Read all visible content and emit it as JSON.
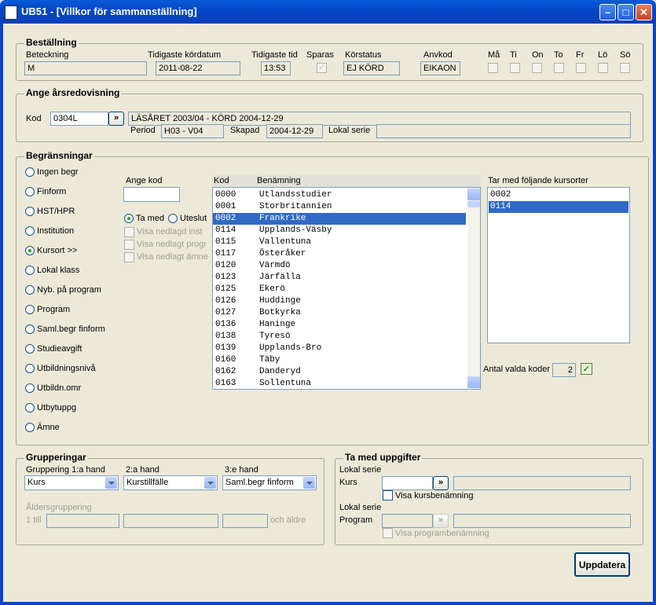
{
  "window": {
    "title": "UB51 - [Villkor för sammanställning]"
  },
  "order": {
    "section_title": "Beställning",
    "labels": {
      "beteckning": "Beteckning",
      "tidigaste_kordatum": "Tidigaste kördatum",
      "tidigaste_tid": "Tidigaste tid",
      "sparas": "Sparas",
      "korstatus": "Körstatus",
      "anvkod": "Anvkod"
    },
    "values": {
      "beteckning": "M",
      "tidigaste_kordatum": "2011-08-22",
      "tidigaste_tid": "13:53",
      "korstatus": "EJ KÖRD",
      "anvkod": "EIKAON"
    },
    "days": [
      "Må",
      "Ti",
      "On",
      "To",
      "Fr",
      "Lö",
      "Sö"
    ]
  },
  "annual": {
    "section_title": "Ange årsredovisning",
    "kod_label": "Kod",
    "kod_value": "0304L",
    "browse_label": "»",
    "description": "LÄSÅRET 2003/04 - KÖRD 2004-12-29",
    "period_label": "Period",
    "period_value": "H03 - V04",
    "skapad_label": "Skapad",
    "skapad_value": "2004-12-29",
    "lokal_serie_label": "Lokal serie",
    "lokal_serie_value": ""
  },
  "limits": {
    "section_title": "Begränsningar",
    "options": [
      "Ingen begr",
      "Finform",
      "HST/HPR",
      "Institution",
      "Kursort >>",
      "Lokal klass",
      "Nyb. på program",
      "Program",
      "Saml.begr finform",
      "Studieavgift",
      "Utbildningsnivå",
      "Utbildn.omr",
      "Utbytuppg",
      "Ämne"
    ],
    "ange_kod_label": "Ange kod",
    "ange_kod_value": "",
    "ta_med_label": "Ta med",
    "uteslut_label": "Uteslut",
    "visa_nedlagd_inst": "Visa nedlagd inst",
    "visa_nedlagt_progr": "Visa nedlagt progr",
    "visa_nedlagt_amne": "Visa nedlagt ämne",
    "list_headers": {
      "kod": "Kod",
      "benamning": "Benämning"
    },
    "list_rows": [
      {
        "kod": "0000",
        "name": "Utlandsstudier"
      },
      {
        "kod": "0001",
        "name": "Storbritannien"
      },
      {
        "kod": "0002",
        "name": "Frankrike"
      },
      {
        "kod": "0114",
        "name": "Upplands-Väsby"
      },
      {
        "kod": "0115",
        "name": "Vallentuna"
      },
      {
        "kod": "0117",
        "name": "Österåker"
      },
      {
        "kod": "0120",
        "name": "Värmdö"
      },
      {
        "kod": "0123",
        "name": "Järfälla"
      },
      {
        "kod": "0125",
        "name": "Ekerö"
      },
      {
        "kod": "0126",
        "name": "Huddinge"
      },
      {
        "kod": "0127",
        "name": "Botkyrka"
      },
      {
        "kod": "0136",
        "name": "Haninge"
      },
      {
        "kod": "0138",
        "name": "Tyresö"
      },
      {
        "kod": "0139",
        "name": "Upplands-Bro"
      },
      {
        "kod": "0160",
        "name": "Täby"
      },
      {
        "kod": "0162",
        "name": "Danderyd"
      },
      {
        "kod": "0163",
        "name": "Sollentuna"
      }
    ],
    "selected_list_row": "0002",
    "tar_med_label": "Tar med följande kursorter",
    "tar_med_items": [
      "0002",
      "0114"
    ],
    "antal_label": "Antal valda koder",
    "antal_value": "2"
  },
  "grouping": {
    "section_title": "Grupperingar",
    "g1_label": "Gruppering 1:a hand",
    "g1_value": "Kurs",
    "g2_label": "2:a hand",
    "g2_value": "Kurstillfälle",
    "g3_label": "3:e hand",
    "g3_value": "Saml.begr finform",
    "alder_label": "Åldersgruppering",
    "till_label": "1 till",
    "och_aldre_label": "och äldre"
  },
  "include": {
    "section_title": "Ta med uppgifter",
    "lokal_serie_label": "Lokal serie",
    "kurs_label": "Kurs",
    "visa_kurs_label": "Visa kursbenämning",
    "lokal_serie2_label": "Lokal serie",
    "program_label": "Program",
    "visa_program_label": "Visa programbenämning",
    "browse_label": "»"
  },
  "update_button": "Uppdatera"
}
